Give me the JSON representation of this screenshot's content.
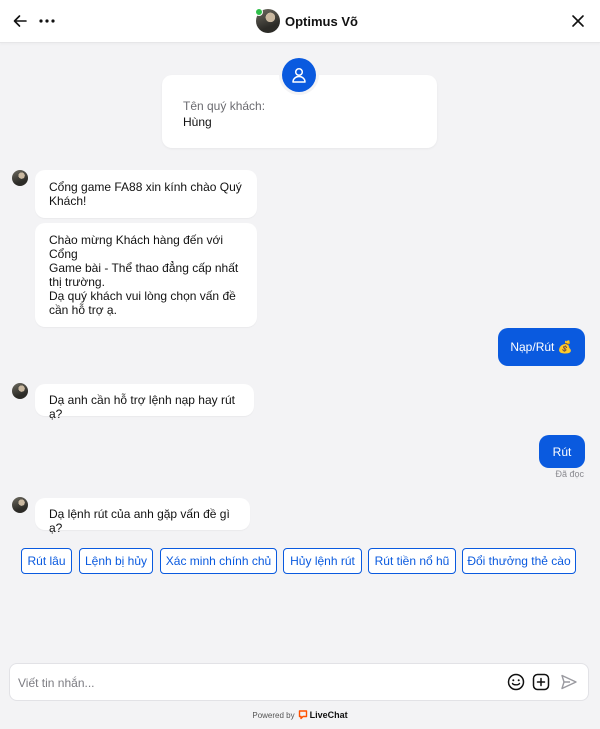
{
  "header": {
    "agent_name": "Optimus Võ",
    "icons": {
      "back": "arrow-left-icon",
      "more": "more-horizontal-icon",
      "close": "close-icon"
    }
  },
  "info_card": {
    "label": "Tên quý khách:",
    "value": "Hùng",
    "icon": "user-icon"
  },
  "messages": [
    {
      "from": "agent",
      "text_lines": [
        "Cổng game FA88 xin kính chào Quý",
        "Khách!"
      ]
    },
    {
      "from": "agent",
      "text_lines": [
        "Chào mừng Khách hàng đến với Cổng",
        "Game bài - Thể thao đẳng cấp nhất",
        "thị trường.",
        "Dạ quý khách vui lòng chọn vấn đề",
        "cần hỗ trợ ạ."
      ]
    },
    {
      "from": "user",
      "text": "Nạp/Rút 💰"
    },
    {
      "from": "agent",
      "text": "Dạ anh cần hỗ trợ lệnh nạp hay rút ạ?"
    },
    {
      "from": "user",
      "text": "Rút",
      "status": "Đã đọc"
    },
    {
      "from": "agent",
      "text": "Dạ lệnh rút của anh gặp vấn đề gì ạ?"
    }
  ],
  "quick_replies": [
    "Rút lâu",
    "Lệnh bị hủy",
    "Xác minh chính chủ",
    "Hủy lệnh rút",
    "Rút tiền nổ hũ",
    "Đổi thưởng thẻ cào"
  ],
  "composer": {
    "placeholder": "Viết tin nhắn...",
    "icons": {
      "emoji": "emoji-icon",
      "attach": "plus-square-icon",
      "send": "send-icon"
    }
  },
  "footer": {
    "powered_by": "Powered by",
    "brand": "LiveChat"
  },
  "colors": {
    "accent": "#0a5adf",
    "background": "#f3f3f5",
    "brand_orange": "#ff5100"
  }
}
